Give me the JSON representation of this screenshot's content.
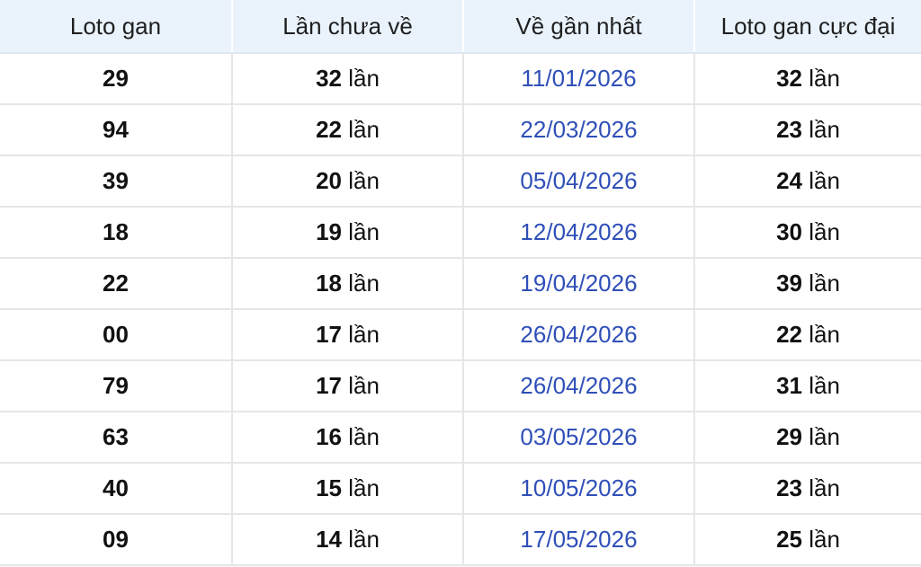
{
  "columns": [
    "Loto gan",
    "Lần chưa về",
    "Về gần nhất",
    "Loto gan cực đại"
  ],
  "unit": "lần",
  "colors": {
    "header_bg": "#eaf3fc",
    "date_text": "#2f4fb8",
    "grid_line": "#e6e6e6"
  },
  "rows": [
    {
      "loto": "29",
      "chua_ve": "32",
      "gan_nhat": "11/01/2026",
      "cuc_dai": "32"
    },
    {
      "loto": "94",
      "chua_ve": "22",
      "gan_nhat": "22/03/2026",
      "cuc_dai": "23"
    },
    {
      "loto": "39",
      "chua_ve": "20",
      "gan_nhat": "05/04/2026",
      "cuc_dai": "24"
    },
    {
      "loto": "18",
      "chua_ve": "19",
      "gan_nhat": "12/04/2026",
      "cuc_dai": "30"
    },
    {
      "loto": "22",
      "chua_ve": "18",
      "gan_nhat": "19/04/2026",
      "cuc_dai": "39"
    },
    {
      "loto": "00",
      "chua_ve": "17",
      "gan_nhat": "26/04/2026",
      "cuc_dai": "22"
    },
    {
      "loto": "79",
      "chua_ve": "17",
      "gan_nhat": "26/04/2026",
      "cuc_dai": "31"
    },
    {
      "loto": "63",
      "chua_ve": "16",
      "gan_nhat": "03/05/2026",
      "cuc_dai": "29"
    },
    {
      "loto": "40",
      "chua_ve": "15",
      "gan_nhat": "10/05/2026",
      "cuc_dai": "23"
    },
    {
      "loto": "09",
      "chua_ve": "14",
      "gan_nhat": "17/05/2026",
      "cuc_dai": "25"
    }
  ]
}
